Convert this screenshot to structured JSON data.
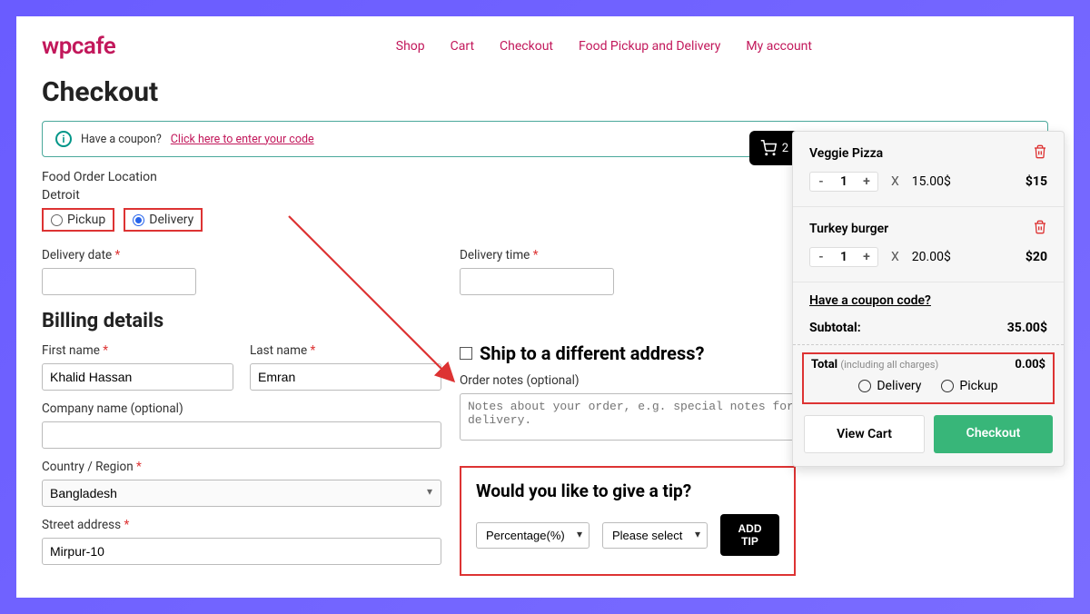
{
  "brand": "wpcafe",
  "nav": {
    "shop": "Shop",
    "cart": "Cart",
    "checkout": "Checkout",
    "pickup_delivery": "Food Pickup and Delivery",
    "account": "My account"
  },
  "page_title": "Checkout",
  "coupon_prompt": {
    "text": "Have a coupon?",
    "link": "Click here to enter your code"
  },
  "location": {
    "label": "Food Order Location",
    "city": "Detroit",
    "pickup": "Pickup",
    "delivery": "Delivery"
  },
  "delivery": {
    "date_label": "Delivery date",
    "time_label": "Delivery time"
  },
  "billing": {
    "title": "Billing details",
    "first_name_label": "First name",
    "last_name_label": "Last name",
    "first_name": "Khalid Hassan",
    "last_name": "Emran",
    "company_label": "Company name (optional)",
    "country_label": "Country / Region",
    "country": "Bangladesh",
    "street_label": "Street address",
    "street": "Mirpur-10"
  },
  "shipping": {
    "heading": "Ship to a different address?",
    "notes_label": "Order notes (optional)",
    "notes_placeholder": "Notes about your order, e.g. special notes for delivery."
  },
  "tip": {
    "title": "Would you like to give a tip?",
    "mode": "Percentage(%)",
    "value": "Please select",
    "add_btn": "ADD TIP"
  },
  "minicart": {
    "badge_count": "2",
    "items": [
      {
        "name": "Veggie Pizza",
        "qty": "1",
        "unit": "15.00$",
        "line": "$15"
      },
      {
        "name": "Turkey burger",
        "qty": "1",
        "unit": "20.00$",
        "line": "$20"
      }
    ],
    "coupon_q": "Have a coupon code?",
    "subtotal_label": "Subtotal:",
    "subtotal": "35.00$",
    "total_label": "Total",
    "total_sub": "(including all charges)",
    "total": "0.00$",
    "opt_delivery": "Delivery",
    "opt_pickup": "Pickup",
    "view_cart": "View Cart",
    "checkout": "Checkout"
  }
}
